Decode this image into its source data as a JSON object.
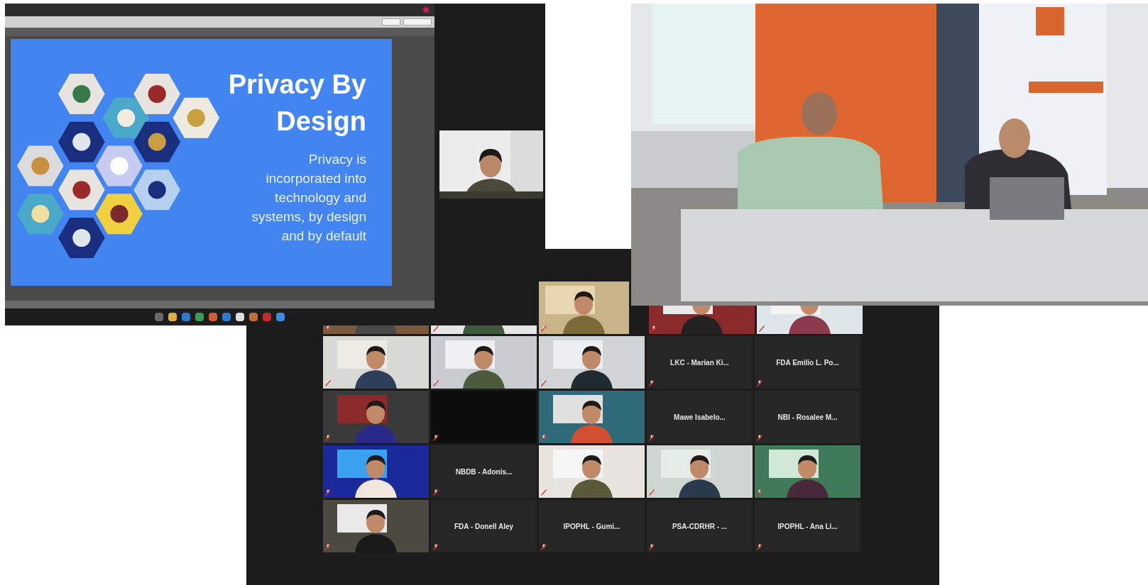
{
  "slide_window": {
    "slide": {
      "title": "Privacy By Design",
      "body": "Privacy is incorporated into technology and systems, by design and by default"
    }
  },
  "gallery": {
    "tiles": [
      {
        "kind": "video",
        "muted": true
      },
      {
        "kind": "video",
        "muted": true
      },
      {
        "kind": "video",
        "muted": true
      },
      {
        "kind": "video",
        "muted": true
      },
      {
        "kind": "video",
        "muted": true
      },
      {
        "kind": "video",
        "muted": true
      },
      {
        "kind": "video",
        "muted": true
      },
      {
        "kind": "video",
        "muted": true
      },
      {
        "kind": "name",
        "name": "LKC - Marian Ki...",
        "muted": true
      },
      {
        "kind": "name",
        "name": "FDA Emilio L. Po...",
        "muted": true
      },
      {
        "kind": "video",
        "muted": true
      },
      {
        "kind": "dark",
        "muted": true
      },
      {
        "kind": "video",
        "muted": true
      },
      {
        "kind": "name",
        "name": "Mawe Isabelo...",
        "muted": true
      },
      {
        "kind": "name",
        "name": "NBI - Rosalee M...",
        "muted": true
      },
      {
        "kind": "video",
        "muted": true
      },
      {
        "kind": "name",
        "name": "NBDB - Adonis...",
        "muted": true
      },
      {
        "kind": "video",
        "muted": true
      },
      {
        "kind": "video",
        "muted": true
      },
      {
        "kind": "video",
        "muted": true
      },
      {
        "kind": "video",
        "muted": true
      },
      {
        "kind": "name",
        "name": "FDA - Donell Aley",
        "muted": true
      },
      {
        "kind": "name",
        "name": "IPOPHL - Gumi...",
        "muted": true
      },
      {
        "kind": "name",
        "name": "PSA-CDRHR - ...",
        "muted": true
      },
      {
        "kind": "name",
        "name": "IPOPHL - Ana Li...",
        "muted": true
      }
    ]
  }
}
